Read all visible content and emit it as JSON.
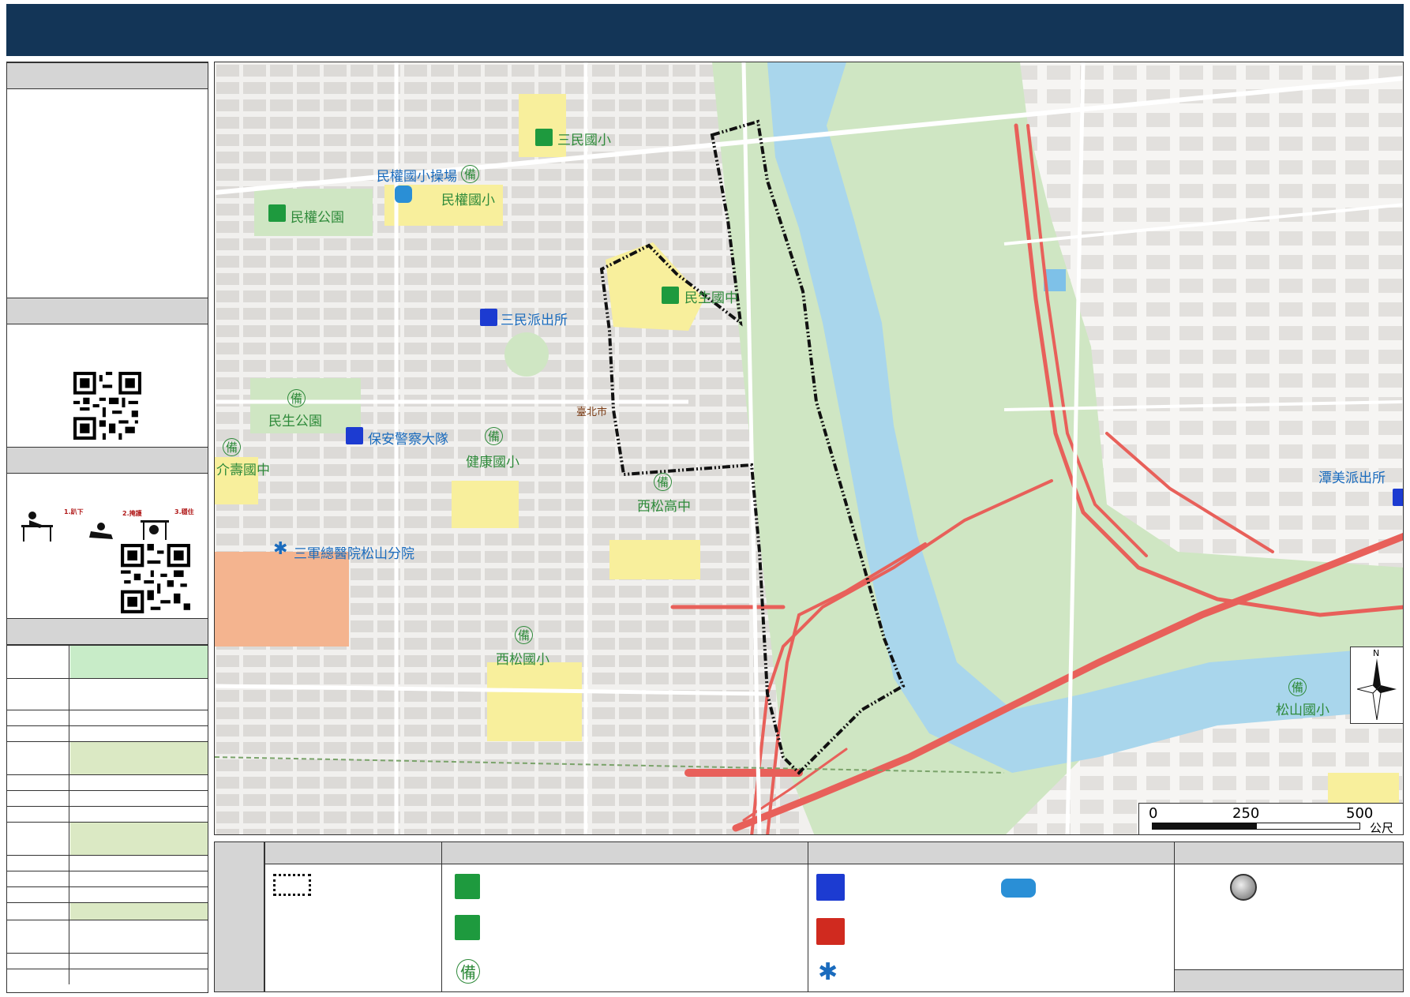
{
  "header": {
    "title": ""
  },
  "map": {
    "labels": {
      "sanmin_elem": "三民國小",
      "minquan_field": "民權國小操場",
      "minquan_elem": "民權國小",
      "minquan_park": "民權公園",
      "minsheng_jhs": "民生國中",
      "sanmin_police": "三民派出所",
      "minsheng_park": "民生公園",
      "security_police": "保安警察大隊",
      "jianjian_elem": "健康國小",
      "jieshou_jhs": "介壽國中",
      "taipei_city": "臺北市",
      "songshan_hs": "西松高中",
      "tri_service_hosp": "三軍總醫院松山分院",
      "xisong_elem": "西松國小",
      "tanmei_police": "潭美派出所",
      "songshan_elem": "松山國小",
      "reserve_char": "備"
    },
    "scale": {
      "t0": "0",
      "t1": "250",
      "t2": "500",
      "unit": "公尺"
    },
    "north": "N"
  },
  "legend": {
    "reserve_char": "備"
  },
  "colors": {
    "header": "#133557",
    "river": "#a9d6ec",
    "park": "#cfe6c3",
    "school": "#f8ef9c",
    "highway": "#e8605a",
    "hospital_area": "#f4b48f"
  }
}
